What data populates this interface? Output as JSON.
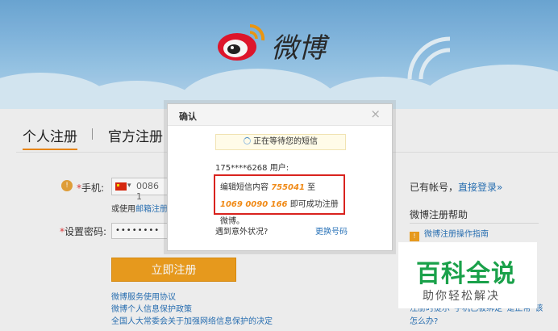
{
  "header": {
    "brand_text": "微博"
  },
  "tabs": {
    "personal": "个人注册",
    "official": "官方注册"
  },
  "form": {
    "phone_label": "手机:",
    "country_code": "0086 1",
    "email_hint_prefix": "或使用",
    "email_hint_link": "邮箱注册",
    "password_label": "设置密码:",
    "password_value": "••••••••",
    "register_button": "立即注册",
    "links": [
      "微博服务使用协议",
      "微博个人信息保护政策",
      "全国人大常委会关于加强网络信息保护的决定"
    ]
  },
  "sidebar": {
    "have_account": "已有帐号，",
    "login_link": "直接登录»",
    "help_title": "微博注册帮助",
    "help_items": [
      "微博注册操作指南"
    ],
    "partial_item": "注册时提示“手机已被绑定”是正常”该怎么办?"
  },
  "dialog": {
    "title": "确认",
    "close": "×",
    "waiting": "正在等待您的短信",
    "user": "175****6268 用户:",
    "sms_prefix": "编辑短信内容",
    "sms_code": "755041",
    "sms_to": "至",
    "sms_number": "1069 0090 166",
    "sms_suffix": "即可成功注册微博。",
    "issue": "遇到意外状况?",
    "change_number": "更换号码"
  },
  "watermark": {
    "title": "百科全说",
    "subtitle": "助你轻松解决"
  }
}
